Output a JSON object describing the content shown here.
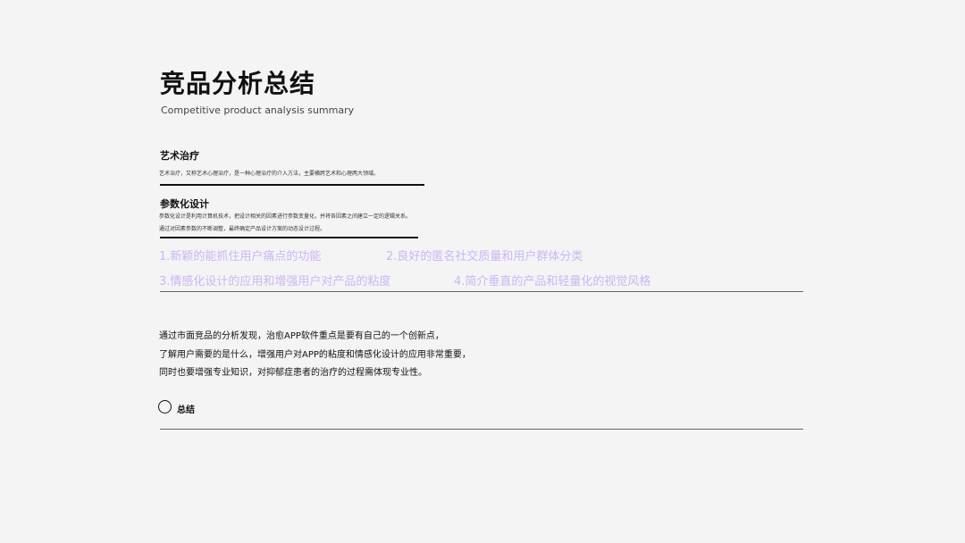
{
  "header": {
    "title": "竞品分析总结",
    "subtitle": "Competitive product analysis summary"
  },
  "sections": [
    {
      "heading": "艺术治疗",
      "description_lines": [
        "艺术治疗，又称艺术心理治疗，是一种心理治疗的介入方法，主要横跨艺术和心理两大领域。"
      ]
    },
    {
      "heading": "参数化设计",
      "description_lines": [
        "参数化设计是利用计算机技术，把设计相关的因素进行参数变量化，并将各因素之间建立一定的逻辑关系。",
        "通过对因素参数的不断调整，最终确定产品设计方案的动态设计过程。"
      ]
    }
  ],
  "features": [
    "1.新颖的能抓住用户痛点的功能",
    "2.良好的匿名社交质量和用户群体分类",
    "3.情感化设计的应用和增强用户对产品的粘度",
    "4.简介垂直的产品和轻量化的视觉风格"
  ],
  "summary_paragraph": [
    "通过市面竞品的分析发现，治愈APP软件重点是要有自己的一个创新点，",
    "了解用户需要的是什么，增强用户对APP的粘度和情感化设计的应用非常重要，",
    "同时也要增强专业知识，对抑郁症患者的治疗的过程需体现专业性。"
  ],
  "summary_label": "总结",
  "colors": {
    "background": "#f4f4f4",
    "feature_text": "#cbb6f5",
    "text": "#111111"
  }
}
